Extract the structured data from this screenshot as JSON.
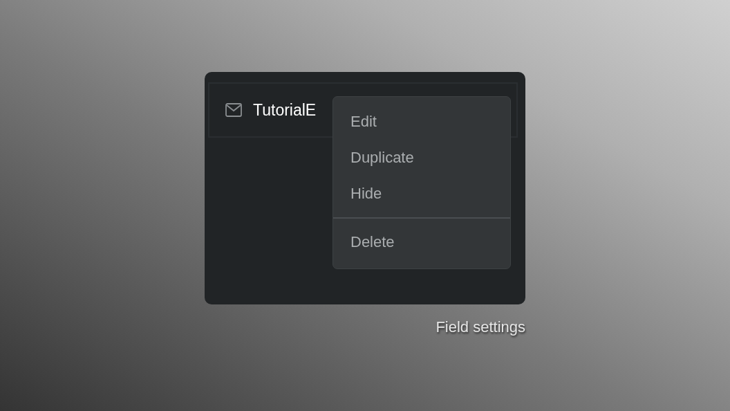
{
  "field": {
    "name": "TutorialE"
  },
  "menu": {
    "groups": [
      [
        "Edit",
        "Duplicate",
        "Hide"
      ],
      [
        "Delete"
      ]
    ]
  },
  "caption": "Field settings"
}
